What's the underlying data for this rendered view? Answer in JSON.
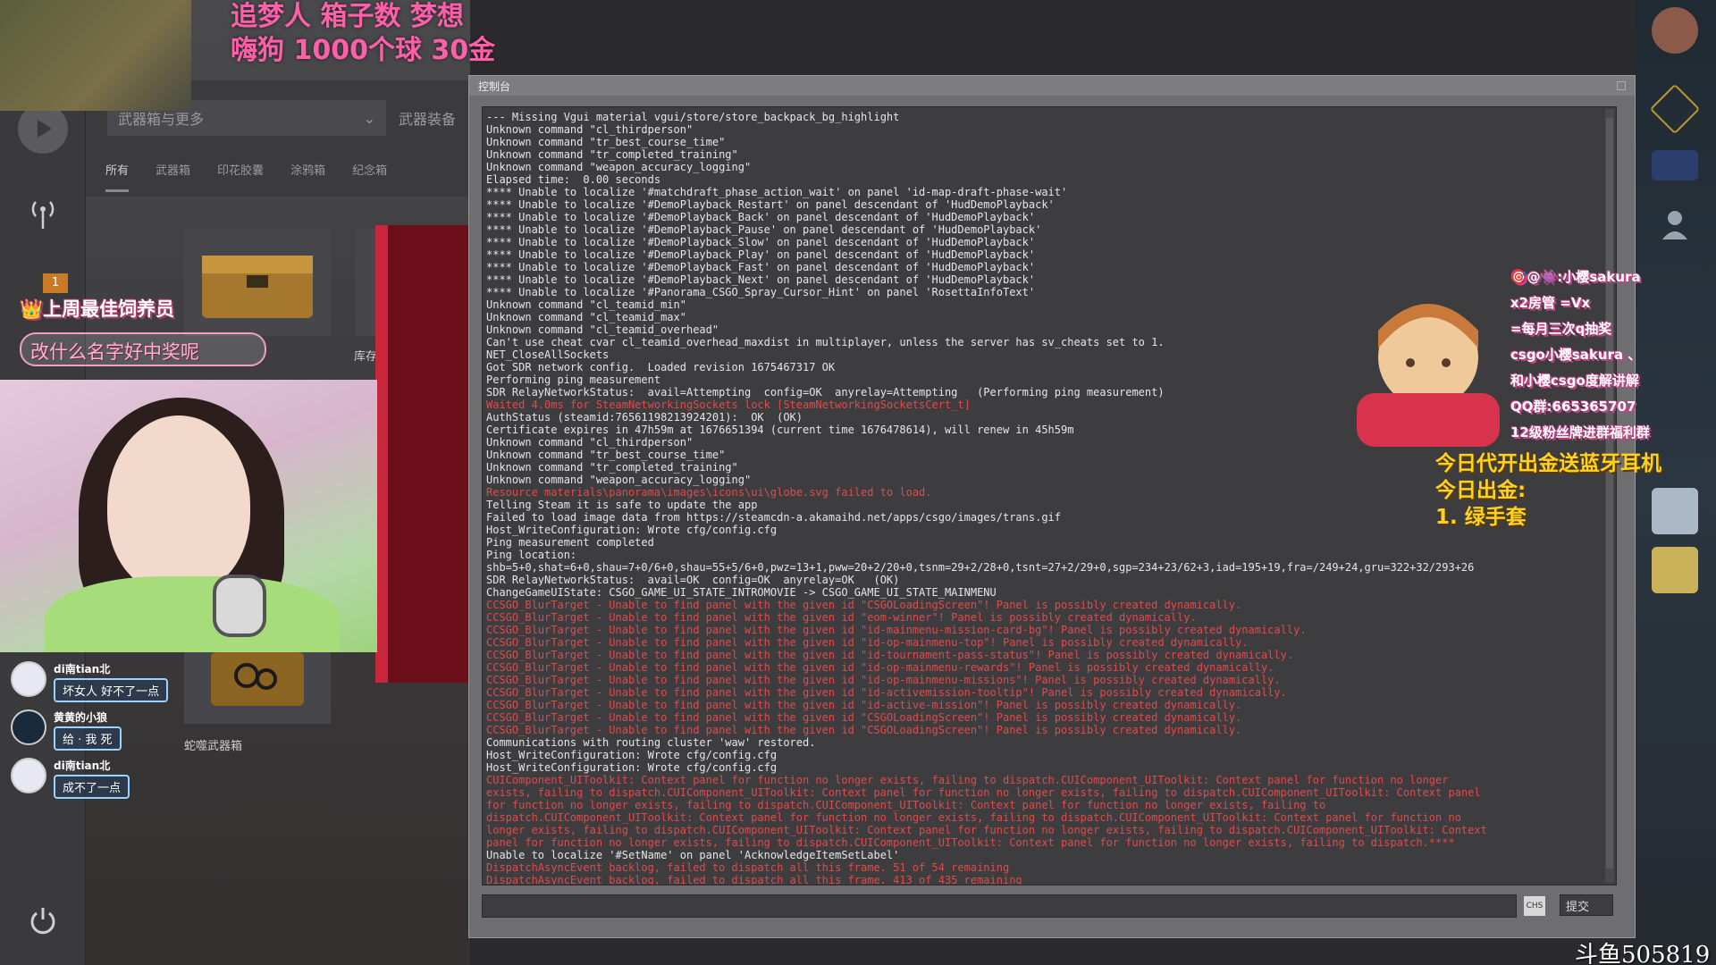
{
  "overlay": {
    "top_line1": "追梦人  箱子数   梦想",
    "top_line2": "嗨狗 1000个球 30金",
    "streamer_badge": "上周最佳饲养员",
    "name_bubble": "改什么名字好中奖呢",
    "badge_number": "1",
    "right_info": [
      "今日代开出金送蓝牙耳机",
      "今日出金:",
      "1. 绿手套"
    ],
    "promo": [
      "🎯@👾:小樱sakura",
      "x2房管  =Vx",
      "=每月三次q抽奖",
      "csgo小樱sakura 、",
      "和小樱csgo度解讲解",
      "QQ群:665365707",
      "12级粉丝牌进群福利群"
    ],
    "watermark": "斗鱼505819"
  },
  "store": {
    "dropdown_label": "武器箱与更多",
    "dropdown2_label": "武器装备",
    "tabs": [
      "所有",
      "武器箱",
      "印花胶囊",
      "涂鸦箱",
      "纪念箱"
    ],
    "case1_label": "库存",
    "case2_label": "蛇噬武器箱"
  },
  "chat": [
    {
      "name": "di南tian北",
      "text": "坏女人 好不了一点"
    },
    {
      "name": "黄黄的小狼",
      "text": "给 · 我 死"
    },
    {
      "name": "di南tian北",
      "text": "成不了一点"
    }
  ],
  "console": {
    "title": "控制台",
    "ime": "CHS",
    "submit": "提交",
    "lines": [
      {
        "t": "--- Missing Vgui material vgui/store/store_backpack_bg_highlight",
        "e": false
      },
      {
        "t": "Unknown command \"cl_thirdperson\"",
        "e": false
      },
      {
        "t": "Unknown command \"tr_best_course_time\"",
        "e": false
      },
      {
        "t": "Unknown command \"tr_completed_training\"",
        "e": false
      },
      {
        "t": "Unknown command \"weapon_accuracy_logging\"",
        "e": false
      },
      {
        "t": "Elapsed time:  0.00 seconds",
        "e": false
      },
      {
        "t": "**** Unable to localize '#matchdraft_phase_action_wait' on panel 'id-map-draft-phase-wait'",
        "e": false
      },
      {
        "t": "**** Unable to localize '#DemoPlayback_Restart' on panel descendant of 'HudDemoPlayback'",
        "e": false
      },
      {
        "t": "**** Unable to localize '#DemoPlayback_Back' on panel descendant of 'HudDemoPlayback'",
        "e": false
      },
      {
        "t": "**** Unable to localize '#DemoPlayback_Pause' on panel descendant of 'HudDemoPlayback'",
        "e": false
      },
      {
        "t": "**** Unable to localize '#DemoPlayback_Slow' on panel descendant of 'HudDemoPlayback'",
        "e": false
      },
      {
        "t": "**** Unable to localize '#DemoPlayback_Play' on panel descendant of 'HudDemoPlayback'",
        "e": false
      },
      {
        "t": "**** Unable to localize '#DemoPlayback_Fast' on panel descendant of 'HudDemoPlayback'",
        "e": false
      },
      {
        "t": "**** Unable to localize '#DemoPlayback_Next' on panel descendant of 'HudDemoPlayback'",
        "e": false
      },
      {
        "t": "**** Unable to localize '#Panorama_CSGO_Spray_Cursor_Hint' on panel 'RosettaInfoText'",
        "e": false
      },
      {
        "t": "Unknown command \"cl_teamid_min\"",
        "e": false
      },
      {
        "t": "Unknown command \"cl_teamid_max\"",
        "e": false
      },
      {
        "t": "Unknown command \"cl_teamid_overhead\"",
        "e": false
      },
      {
        "t": "Can't use cheat cvar cl_teamid_overhead_maxdist in multiplayer, unless the server has sv_cheats set to 1.",
        "e": false
      },
      {
        "t": "NET_CloseAllSockets",
        "e": false
      },
      {
        "t": "Got SDR network config.  Loaded revision 1675467317 OK",
        "e": false
      },
      {
        "t": "Performing ping measurement",
        "e": false
      },
      {
        "t": "SDR RelayNetworkStatus:  avail=Attempting  config=OK  anyrelay=Attempting   (Performing ping measurement)",
        "e": false
      },
      {
        "t": "Waited 4.0ms for SteamNetworkingSockets lock [SteamNetworkingSocketsCert_t]",
        "e": true
      },
      {
        "t": "AuthStatus (steamid:76561198213924201):  OK  (OK)",
        "e": false
      },
      {
        "t": "Certificate expires in 47h59m at 1676651394 (current time 1676478614), will renew in 45h59m",
        "e": false
      },
      {
        "t": "Unknown command \"cl_thirdperson\"",
        "e": false
      },
      {
        "t": "Unknown command \"tr_best_course_time\"",
        "e": false
      },
      {
        "t": "Unknown command \"tr_completed_training\"",
        "e": false
      },
      {
        "t": "Unknown command \"weapon_accuracy_logging\"",
        "e": false
      },
      {
        "t": "Resource materials\\panorama\\images\\icons\\ui\\globe.svg failed to load.",
        "e": true
      },
      {
        "t": "Telling Steam it is safe to update the app",
        "e": false
      },
      {
        "t": "Failed to load image data from https://steamcdn-a.akamaihd.net/apps/csgo/images/trans.gif",
        "e": false
      },
      {
        "t": "Host_WriteConfiguration: Wrote cfg/config.cfg",
        "e": false
      },
      {
        "t": "Ping measurement completed",
        "e": false
      },
      {
        "t": "Ping location:",
        "e": false
      },
      {
        "t": "shb=5+0,shat=6+0,shau=7+0/6+0,shau=55+5/6+0,pwz=13+1,pww=20+2/20+0,tsnm=29+2/28+0,tsnt=27+2/29+0,sgp=234+23/62+3,iad=195+19,fra=/249+24,gru=322+32/293+26",
        "e": false
      },
      {
        "t": "SDR RelayNetworkStatus:  avail=OK  config=OK  anyrelay=OK   (OK)",
        "e": false
      },
      {
        "t": "ChangeGameUIState: CSGO_GAME_UI_STATE_INTROMOVIE -> CSGO_GAME_UI_STATE_MAINMENU",
        "e": false
      },
      {
        "t": "CCSGO_BlurTarget - Unable to find panel with the given id \"CSGOLoadingScreen\"! Panel is possibly created dynamically.",
        "e": true
      },
      {
        "t": "CCSGO_BlurTarget - Unable to find panel with the given id \"eom-winner\"! Panel is possibly created dynamically.",
        "e": true
      },
      {
        "t": "CCSGO_BlurTarget - Unable to find panel with the given id \"id-mainmenu-mission-card-bg\"! Panel is possibly created dynamically.",
        "e": true
      },
      {
        "t": "CCSGO_BlurTarget - Unable to find panel with the given id \"id-op-mainmenu-top\"! Panel is possibly created dynamically.",
        "e": true
      },
      {
        "t": "CCSGO_BlurTarget - Unable to find panel with the given id \"id-tournament-pass-status\"! Panel is possibly created dynamically.",
        "e": true
      },
      {
        "t": "CCSGO_BlurTarget - Unable to find panel with the given id \"id-op-mainmenu-rewards\"! Panel is possibly created dynamically.",
        "e": true
      },
      {
        "t": "CCSGO_BlurTarget - Unable to find panel with the given id \"id-op-mainmenu-missions\"! Panel is possibly created dynamically.",
        "e": true
      },
      {
        "t": "CCSGO_BlurTarget - Unable to find panel with the given id \"id-activemission-tooltip\"! Panel is possibly created dynamically.",
        "e": true
      },
      {
        "t": "CCSGO_BlurTarget - Unable to find panel with the given id \"id-active-mission\"! Panel is possibly created dynamically.",
        "e": true
      },
      {
        "t": "CCSGO_BlurTarget - Unable to find panel with the given id \"CSGOLoadingScreen\"! Panel is possibly created dynamically.",
        "e": true
      },
      {
        "t": "CCSGO_BlurTarget - Unable to find panel with the given id \"CSGOLoadingScreen\"! Panel is possibly created dynamically.",
        "e": true
      },
      {
        "t": "Communications with routing cluster 'waw' restored.",
        "e": false
      },
      {
        "t": "Host_WriteConfiguration: Wrote cfg/config.cfg",
        "e": false
      },
      {
        "t": "Host_WriteConfiguration: Wrote cfg/config.cfg",
        "e": false
      },
      {
        "t": "CUIComponent_UIToolkit: Context panel for function no longer exists, failing to dispatch.CUIComponent_UIToolkit: Context panel for function no longer",
        "e": true
      },
      {
        "t": "exists, failing to dispatch.CUIComponent_UIToolkit: Context panel for function no longer exists, failing to dispatch.CUIComponent_UIToolkit: Context panel",
        "e": true
      },
      {
        "t": "for function no longer exists, failing to dispatch.CUIComponent_UIToolkit: Context panel for function no longer exists, failing to",
        "e": true
      },
      {
        "t": "dispatch.CUIComponent_UIToolkit: Context panel for function no longer exists, failing to dispatch.CUIComponent_UIToolkit: Context panel for function no",
        "e": true
      },
      {
        "t": "longer exists, failing to dispatch.CUIComponent_UIToolkit: Context panel for function no longer exists, failing to dispatch.CUIComponent_UIToolkit: Context",
        "e": true
      },
      {
        "t": "panel for function no longer exists, failing to dispatch.CUIComponent_UIToolkit: Context panel for function no longer exists, failing to dispatch.****",
        "e": true
      },
      {
        "t": "Unable to localize '#SetName' on panel 'AcknowledgeItemSetLabel'",
        "e": false
      },
      {
        "t": "DispatchAsyncEvent backlog, failed to dispatch all this frame. 51 of 54 remaining",
        "e": true
      },
      {
        "t": "DispatchAsyncEvent backlog, failed to dispatch all this frame. 413 of 435 remaining",
        "e": true
      }
    ]
  },
  "colors": {
    "error_text": "#e04a4a",
    "console_bg": "#3d3d40",
    "accent_pink": "#ff5fa8",
    "accent_gold": "#ffd21f"
  }
}
